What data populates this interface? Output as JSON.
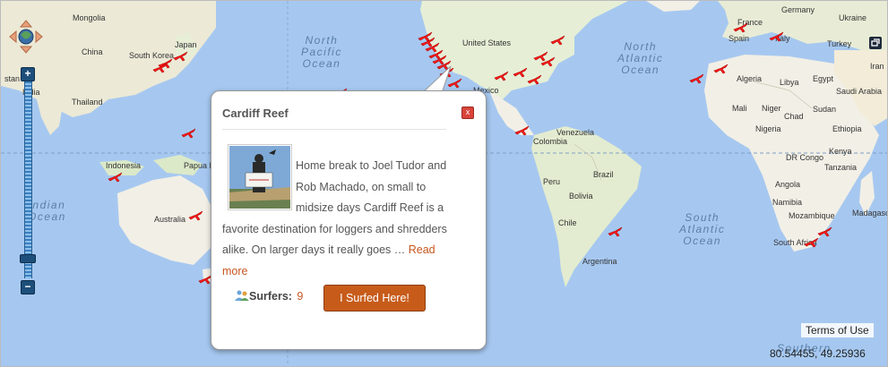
{
  "map": {
    "oceans": [
      {
        "key": "north_pacific",
        "line1": "North",
        "line2": "Pacific",
        "line3": "Ocean"
      },
      {
        "key": "north_atlantic",
        "line1": "North",
        "line2": "Atlantic",
        "line3": "Ocean"
      },
      {
        "key": "indian",
        "line1": "Indian",
        "line2": "Ocean"
      },
      {
        "key": "south_atlantic",
        "line1": "South",
        "line2": "Atlantic",
        "line3": "Ocean"
      },
      {
        "key": "southern",
        "line1": "Southern"
      }
    ],
    "labels": {
      "germany": "Germany",
      "ukraine": "Ukraine",
      "france": "France",
      "spain": "Spain",
      "italy": "Italy",
      "turkey": "Turkey",
      "iran": "Iran",
      "mongolia": "Mongolia",
      "china": "China",
      "japan": "Japan",
      "south_korea": "South Korea",
      "india": "India",
      "thailand": "Thailand",
      "indonesia": "Indonesia",
      "papua": "Papua N",
      "australia": "Australia",
      "united_states": "United States",
      "mexico": "Mexico",
      "venezuela": "Venezuela",
      "colombia": "Colombia",
      "peru": "Peru",
      "brazil": "Brazil",
      "bolivia": "Bolivia",
      "chile": "Chile",
      "argentina": "Argentina",
      "algeria": "Algeria",
      "libya": "Libya",
      "egypt": "Egypt",
      "saudi_arabia": "Saudi Arabia",
      "mali": "Mali",
      "niger": "Niger",
      "chad": "Chad",
      "sudan": "Sudan",
      "ethiopia": "Ethiopia",
      "nigeria": "Nigeria",
      "dr_congo": "DR Congo",
      "kenya": "Kenya",
      "tanzania": "Tanzania",
      "angola": "Angola",
      "namibia": "Namibia",
      "mozambique": "Mozambique",
      "madagascar": "Madagascar",
      "south_africa": "South Africa",
      "stan": "stan"
    },
    "terms_label": "Terms of Use",
    "coordinates": "80.54455, 49.25936"
  },
  "popup": {
    "title": "Cardiff Reef",
    "description_part1": "Home break to Joel Tudor and Rob Machado, on small to midsize days Cardiff Reef is a favorite destination for loggers and shredders alike. On larger days it really goes … ",
    "read_more": "Read more",
    "surfers_label": "Surfers:",
    "surfers_count": "9",
    "surfed_button": "I Surfed Here!",
    "close_label": "x"
  },
  "colors": {
    "ocean": "#a6c8f0",
    "land": "#f2efe6",
    "marker": "#ff1a1a",
    "accent": "#c75b1a"
  },
  "icons": {
    "marker": "surfboard-marker-icon",
    "pan": "pan-control-icon",
    "fullscreen": "fullscreen-icon",
    "surfers": "surfers-icon",
    "close": "close-icon"
  }
}
